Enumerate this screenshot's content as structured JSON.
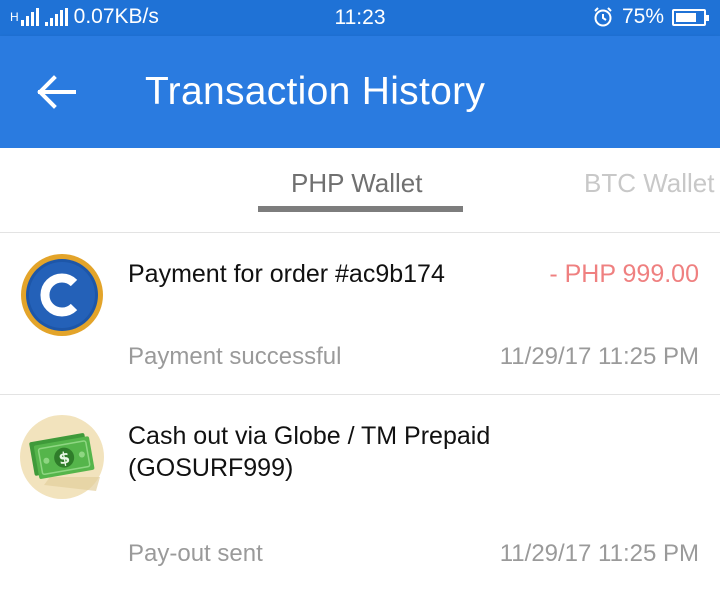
{
  "status_bar": {
    "network": "H",
    "speed": "0.07KB/s",
    "time": "11:23",
    "alarm_icon": "alarm-clock-icon",
    "battery": "75%",
    "battery_level": 0.75
  },
  "app_bar": {
    "back_icon": "arrow-left-icon",
    "title": "Transaction History",
    "color": "#2a7be0"
  },
  "tabs": [
    {
      "label": "PHP Wallet",
      "selected": true
    },
    {
      "label": "BTC Wallet",
      "selected": false
    }
  ],
  "transactions": [
    {
      "icon": "coins-ph-logo-icon",
      "title": "Payment for order #ac9b174",
      "amount": "- PHP 999.00",
      "status": "Payment successful",
      "datetime": "11/29/17 11:25 PM"
    },
    {
      "icon": "cash-money-icon",
      "title": "Cash out via Globe / TM Prepaid (GOSURF999)",
      "amount": "",
      "status": "Pay-out sent",
      "datetime": "11/29/17 11:25 PM"
    }
  ],
  "colors": {
    "status_bar": "#1f72d6",
    "app_bar": "#2a7be0",
    "amount_negative": "#ef8080",
    "muted_text": "#9a9a9a"
  }
}
